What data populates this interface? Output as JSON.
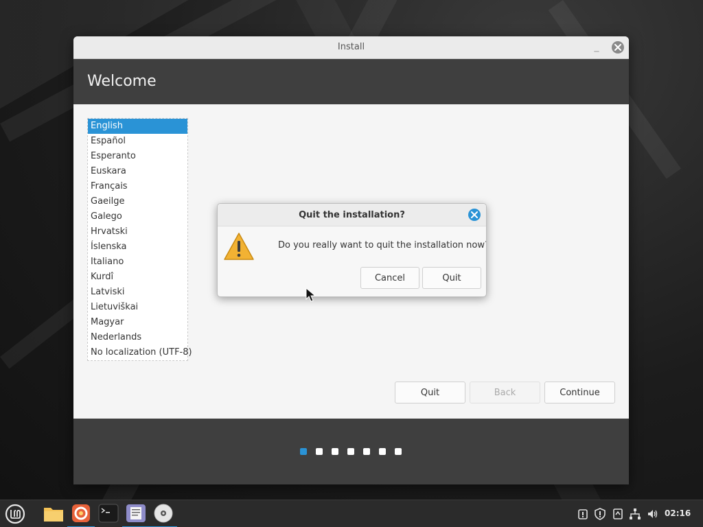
{
  "window": {
    "title": "Install",
    "header_title": "Welcome"
  },
  "languages": {
    "items": [
      "English",
      "Español",
      "Esperanto",
      "Euskara",
      "Français",
      "Gaeilge",
      "Galego",
      "Hrvatski",
      "Íslenska",
      "Italiano",
      "Kurdî",
      "Latviski",
      "Lietuviškai",
      "Magyar",
      "Nederlands",
      "No localization (UTF-8)"
    ],
    "selected": "English"
  },
  "buttons": {
    "quit": "Quit",
    "back": "Back",
    "continue": "Continue"
  },
  "progress": {
    "total_steps": 7,
    "current_step": 1
  },
  "dialog": {
    "title": "Quit the installation?",
    "message": "Do you really want to quit the installation now?",
    "cancel": "Cancel",
    "quit": "Quit"
  },
  "taskbar": {
    "clock": "02:16"
  },
  "colors": {
    "accent": "#2a93d6",
    "header_bg": "#3f3f3f",
    "warning": "#f2b233"
  },
  "icons": {
    "menu": "mint-menu-icon",
    "files": "folder-icon",
    "browser": "firefox-icon",
    "terminal": "terminal-icon",
    "editor": "text-editor-icon",
    "installer": "disc-icon"
  }
}
